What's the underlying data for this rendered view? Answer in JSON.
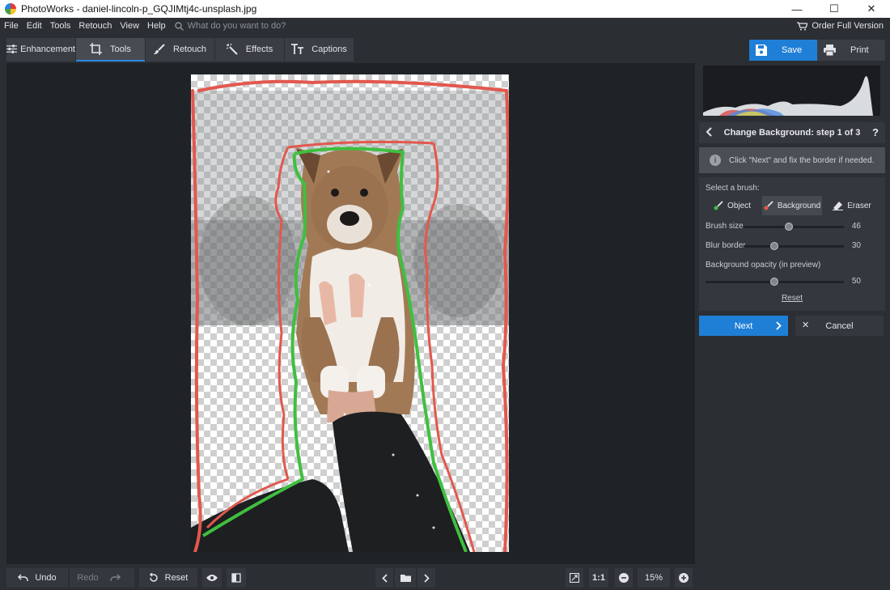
{
  "window": {
    "title": "PhotoWorks - daniel-lincoln-p_GQJIMtj4c-unsplash.jpg",
    "controls": [
      "minimize",
      "maximize",
      "close"
    ]
  },
  "menu": {
    "items": [
      "File",
      "Edit",
      "Tools",
      "Retouch",
      "View",
      "Help"
    ],
    "search_placeholder": "What do you want to do?",
    "order_label": "Order Full Version"
  },
  "toolbar": {
    "tabs": [
      {
        "label": "Enhancement",
        "icon": "sliders-icon"
      },
      {
        "label": "Tools",
        "icon": "crop-icon",
        "active": true
      },
      {
        "label": "Retouch",
        "icon": "brush-icon"
      },
      {
        "label": "Effects",
        "icon": "magic-wand-icon"
      },
      {
        "label": "Captions",
        "icon": "text-icon"
      }
    ],
    "save_label": "Save",
    "print_label": "Print"
  },
  "panel": {
    "step_title": "Change Background: step 1 of 3",
    "help": "?",
    "info_text": "Click \"Next\" and fix the border if needed.",
    "select_brush_label": "Select a brush:",
    "brushes": [
      {
        "label": "Object",
        "color": "#3fbf3f"
      },
      {
        "label": "Background",
        "color": "#e2584d",
        "active": true
      },
      {
        "label": "Eraser"
      }
    ],
    "brush_size": {
      "label": "Brush size",
      "value": "46",
      "fraction": 0.46
    },
    "blur_border": {
      "label": "Blur border",
      "value": "30",
      "fraction": 0.3
    },
    "bg_opacity": {
      "label": "Background opacity (in preview)",
      "value": "50",
      "fraction": 0.5
    },
    "reset_label": "Reset",
    "next_label": "Next",
    "cancel_label": "Cancel"
  },
  "bottom": {
    "undo_label": "Undo",
    "redo_label": "Redo",
    "reset_label": "Reset",
    "ratio_label": "1:1",
    "zoom_label": "15%"
  },
  "colors": {
    "accent": "#1f7fd6",
    "object_stroke": "#3fbf3f",
    "background_stroke": "#e2584d"
  }
}
